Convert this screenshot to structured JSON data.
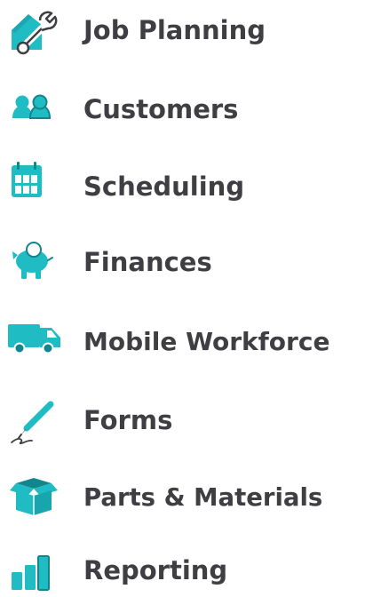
{
  "colors": {
    "accent": "#1fbcc4",
    "accent_dark": "#13858c",
    "text": "#3f3f43",
    "background": "#ffffff"
  },
  "features": [
    {
      "label": "Job Planning",
      "icon": "wrench-house-icon"
    },
    {
      "label": "Customers",
      "icon": "people-icon"
    },
    {
      "label": "Scheduling",
      "icon": "calendar-icon"
    },
    {
      "label": "Finances",
      "icon": "piggy-bank-icon"
    },
    {
      "label": "Mobile Workforce",
      "icon": "van-icon"
    },
    {
      "label": "Forms",
      "icon": "pen-signature-icon"
    },
    {
      "label": "Parts & Materials",
      "icon": "box-icon"
    },
    {
      "label": "Reporting",
      "icon": "bar-chart-icon"
    }
  ]
}
